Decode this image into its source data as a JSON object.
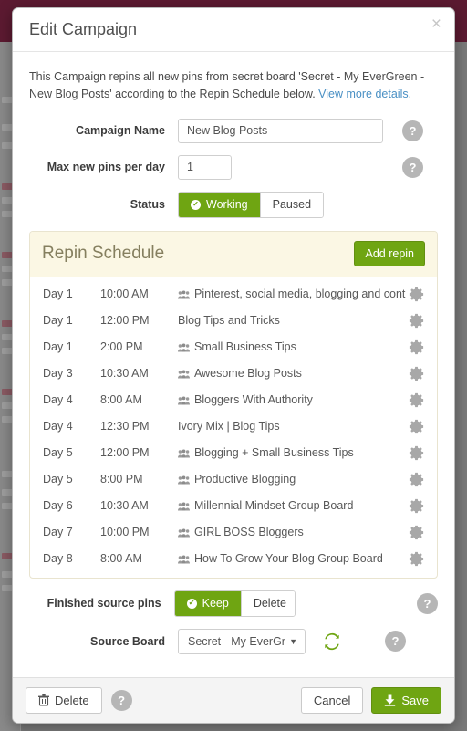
{
  "dialog": {
    "title": "Edit Campaign",
    "close_label": "×",
    "intro_text": "This Campaign repins all new pins from secret board 'Secret - My EverGreen - New Blog Posts' according to the Repin Schedule below. ",
    "intro_link": "View more details."
  },
  "form": {
    "campaign_name": {
      "label": "Campaign Name",
      "value": "New Blog Posts",
      "placeholder": "New Blog Posts"
    },
    "max_pins": {
      "label": "Max new pins per day",
      "value": "1",
      "placeholder": "1"
    },
    "status": {
      "label": "Status",
      "selected": "Working",
      "options": [
        "Working",
        "Paused"
      ]
    },
    "finished_source_pins": {
      "label": "Finished source pins",
      "selected": "Keep",
      "options": [
        "Keep",
        "Delete"
      ]
    },
    "source_board": {
      "label": "Source Board",
      "value": "Secret - My EverGr"
    },
    "help_label": "?"
  },
  "schedule": {
    "title": "Repin Schedule",
    "add_button": "Add repin",
    "rows": [
      {
        "day": "Day 1",
        "time": "10:00 AM",
        "board": "Pinterest, social media, blogging and cont…",
        "group": true
      },
      {
        "day": "Day 1",
        "time": "12:00 PM",
        "board": "Blog Tips and Tricks",
        "group": false
      },
      {
        "day": "Day 1",
        "time": "2:00 PM",
        "board": "Small Business Tips",
        "group": true
      },
      {
        "day": "Day 3",
        "time": "10:30 AM",
        "board": "Awesome Blog Posts",
        "group": true
      },
      {
        "day": "Day 4",
        "time": "8:00 AM",
        "board": "Bloggers With Authority",
        "group": true
      },
      {
        "day": "Day 4",
        "time": "12:30 PM",
        "board": "Ivory Mix | Blog Tips",
        "group": false
      },
      {
        "day": "Day 5",
        "time": "12:00 PM",
        "board": "Blogging + Small Business Tips",
        "group": true
      },
      {
        "day": "Day 5",
        "time": "8:00 PM",
        "board": "Productive Blogging",
        "group": true
      },
      {
        "day": "Day 6",
        "time": "10:30 AM",
        "board": "Millennial Mindset Group Board",
        "group": true
      },
      {
        "day": "Day 7",
        "time": "10:00 PM",
        "board": "GIRL BOSS Bloggers",
        "group": true
      },
      {
        "day": "Day 8",
        "time": "8:00 AM",
        "board": "How To Grow Your Blog Group Board",
        "group": true
      }
    ]
  },
  "footer": {
    "delete_label": "Delete",
    "help_label": "?",
    "cancel_label": "Cancel",
    "save_label": "Save"
  },
  "colors": {
    "green": "#6fa512",
    "schedule_header_bg": "#fbf7e4",
    "topbar_maroon": "#5c1a31",
    "link_blue": "#4a90c4",
    "help_gray": "#b6b6b6"
  }
}
